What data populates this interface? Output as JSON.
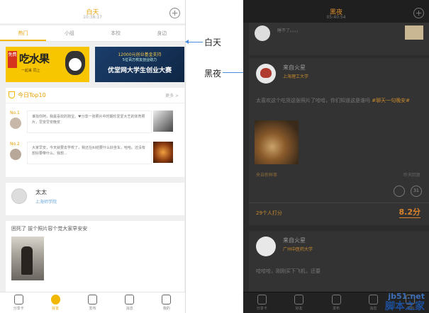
{
  "day": {
    "status_title": "白天",
    "status_time": "10:38:17",
    "tabs": [
      "热门",
      "小组",
      "本校",
      "身边"
    ],
    "banner1": {
      "tag": "免费",
      "title": "吃水果",
      "sub": "一起来  同上"
    },
    "banner2": {
      "top": "12000元创业基金支持",
      "mid": "5位百万校友创业助力",
      "title": "优堂网大学生创业大赛"
    },
    "top10": {
      "title": "今日Top10",
      "more": "更多 >",
      "items": [
        {
          "rank": "No.1",
          "text": "谁找你阿，我最喜欢的狗宝。♥分享一张照片中时期珍爱爱大艺的体育照片，早安早安晚安"
        },
        {
          "rank": "No.2",
          "text": "大家早安，今天就要去学校了，我还在纠结要什么好坐车，哈哈。还没有想好要带什么。我想..."
        }
      ]
    },
    "post1": {
      "name": "太太",
      "school": "上海师学院"
    },
    "post2": {
      "text": "困死了 拔个照片容个觉大家早安安"
    },
    "nav": [
      "分享卡",
      "好友",
      "发布",
      "消息",
      "我的"
    ]
  },
  "annotations": {
    "day_label": "白天",
    "night_label": "黑夜"
  },
  "night": {
    "status_title": "黑夜",
    "status_time": "05:40:54",
    "card0_msg": "睡不了。。。。",
    "card1": {
      "name": "来自火星",
      "school": "上海理工大学",
      "body": "太喜欢这个吃货这张照片了哈哈，你们知道这是谁吗",
      "tag": "#聊天一句晚安#",
      "from": "来自新鲜事",
      "time": "昨天回复",
      "icon_b": "31",
      "likes": "29个人打分",
      "score": "8.2分"
    },
    "card2": {
      "name": "来自火星",
      "school": "广州中医药大学",
      "body": "哈哈哈，刚刚买下飞机，还要"
    },
    "nav": [
      "分享卡",
      "好友",
      "发布",
      "消息",
      "我的"
    ]
  },
  "watermark": {
    "line1": "jb51.net",
    "line2": "脚本之家"
  }
}
